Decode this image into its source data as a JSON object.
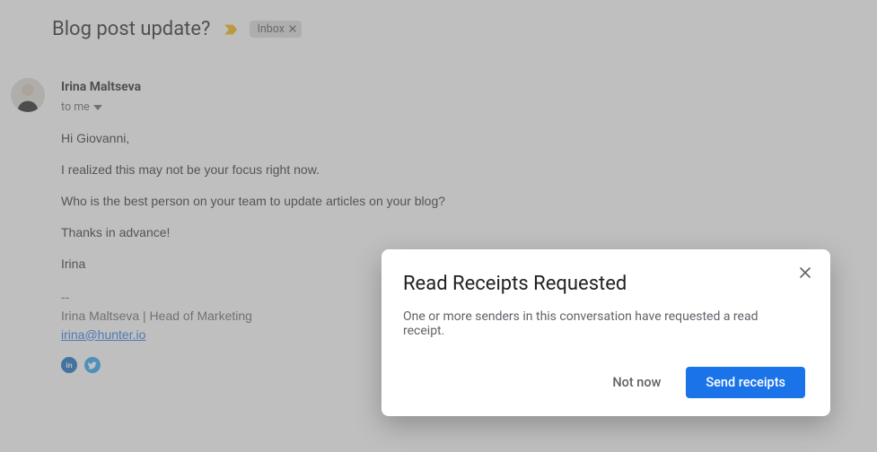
{
  "thread": {
    "subject": "Blog post update?",
    "labels": [
      {
        "name": "Inbox"
      }
    ]
  },
  "message": {
    "from_name": "Irina Maltseva",
    "to_label": "to me",
    "body_lines": [
      "Hi Giovanni,",
      "I realized this may not be your focus right now.",
      "Who is the best person on your team to update articles on your blog?",
      "Thanks in advance!",
      "Irina"
    ],
    "signature_prefix": "--",
    "signature_line": "Irina Maltseva | Head of Marketing",
    "signature_email": "irina@hunter.io",
    "social": [
      {
        "id": "linkedin",
        "color": "#0a66c2"
      },
      {
        "id": "twitter",
        "color": "#1da1f2"
      }
    ]
  },
  "dialog": {
    "title": "Read Receipts Requested",
    "body": "One or more senders in this conversation have requested a read receipt.",
    "not_now": "Not now",
    "send": "Send receipts"
  }
}
